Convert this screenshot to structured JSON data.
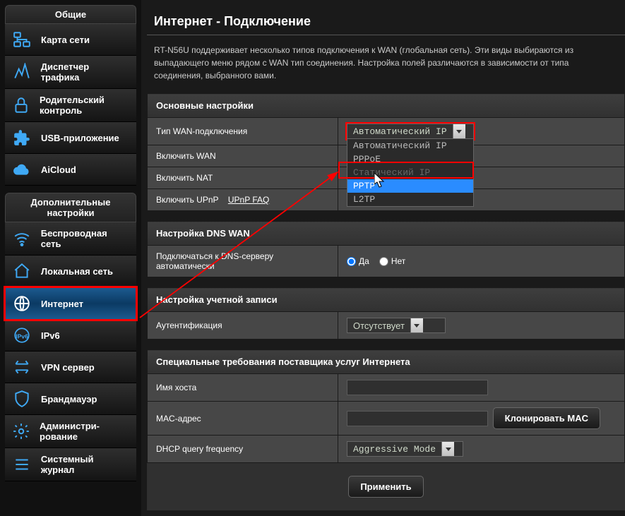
{
  "sidebar": {
    "general_header": "Общие",
    "advanced_header": "Дополнительные настройки",
    "general": [
      {
        "id": "network-map",
        "label": "Карта сети"
      },
      {
        "id": "traffic-manager",
        "label": "Диспетчер трафика"
      },
      {
        "id": "parental",
        "label": "Родительский контроль"
      },
      {
        "id": "usb-app",
        "label": "USB-приложение"
      },
      {
        "id": "aicloud",
        "label": "AiCloud"
      }
    ],
    "advanced": [
      {
        "id": "wireless",
        "label": "Беспроводная сеть"
      },
      {
        "id": "lan",
        "label": "Локальная сеть"
      },
      {
        "id": "internet",
        "label": "Интернет"
      },
      {
        "id": "ipv6",
        "label": "IPv6"
      },
      {
        "id": "vpn",
        "label": "VPN сервер"
      },
      {
        "id": "firewall",
        "label": "Брандмауэр"
      },
      {
        "id": "admin",
        "label": "Администри-рование"
      },
      {
        "id": "syslog",
        "label": "Системный журнал"
      }
    ]
  },
  "page": {
    "title": "Интернет - Подключение",
    "intro": "RT-N56U поддерживает несколько типов подключения к WAN (глобальная сеть). Эти виды выбираются из выпадающего меню рядом с WAN тип соединения. Настройка полей различаются в зависимости от типа соединения, выбранного вами."
  },
  "sections": {
    "basic": {
      "header": "Основные настройки",
      "wan_type_label": "Tип WAN-подключения",
      "wan_type_value": "Автоматический IP",
      "wan_type_options": [
        "Автоматический IP",
        "PPPoE",
        "Статический IP",
        "PPTP",
        "L2TP"
      ],
      "enable_wan_label": "Включить WAN",
      "enable_nat_label": "Включить NAT",
      "enable_upnp_label": "Включить UPnP",
      "upnp_faq": "UPnP  FAQ"
    },
    "dns": {
      "header": "Настройка DNS WAN",
      "auto_label": "Подключаться к DNS-серверу автоматически"
    },
    "account": {
      "header": "Настройка учетной записи",
      "auth_label": "Аутентификация",
      "auth_value": "Отсутствует"
    },
    "isp": {
      "header": "Специальные требования поставщика услуг Интернета",
      "host_label": "Имя хоста",
      "mac_label": "MAC-адрес",
      "mac_clone_btn": "Клонировать MAC",
      "dhcp_label": "DHCP query frequency",
      "dhcp_value": "Aggressive Mode"
    }
  },
  "radio": {
    "yes": "Да",
    "no": "Нет"
  },
  "apply_btn": "Применить"
}
